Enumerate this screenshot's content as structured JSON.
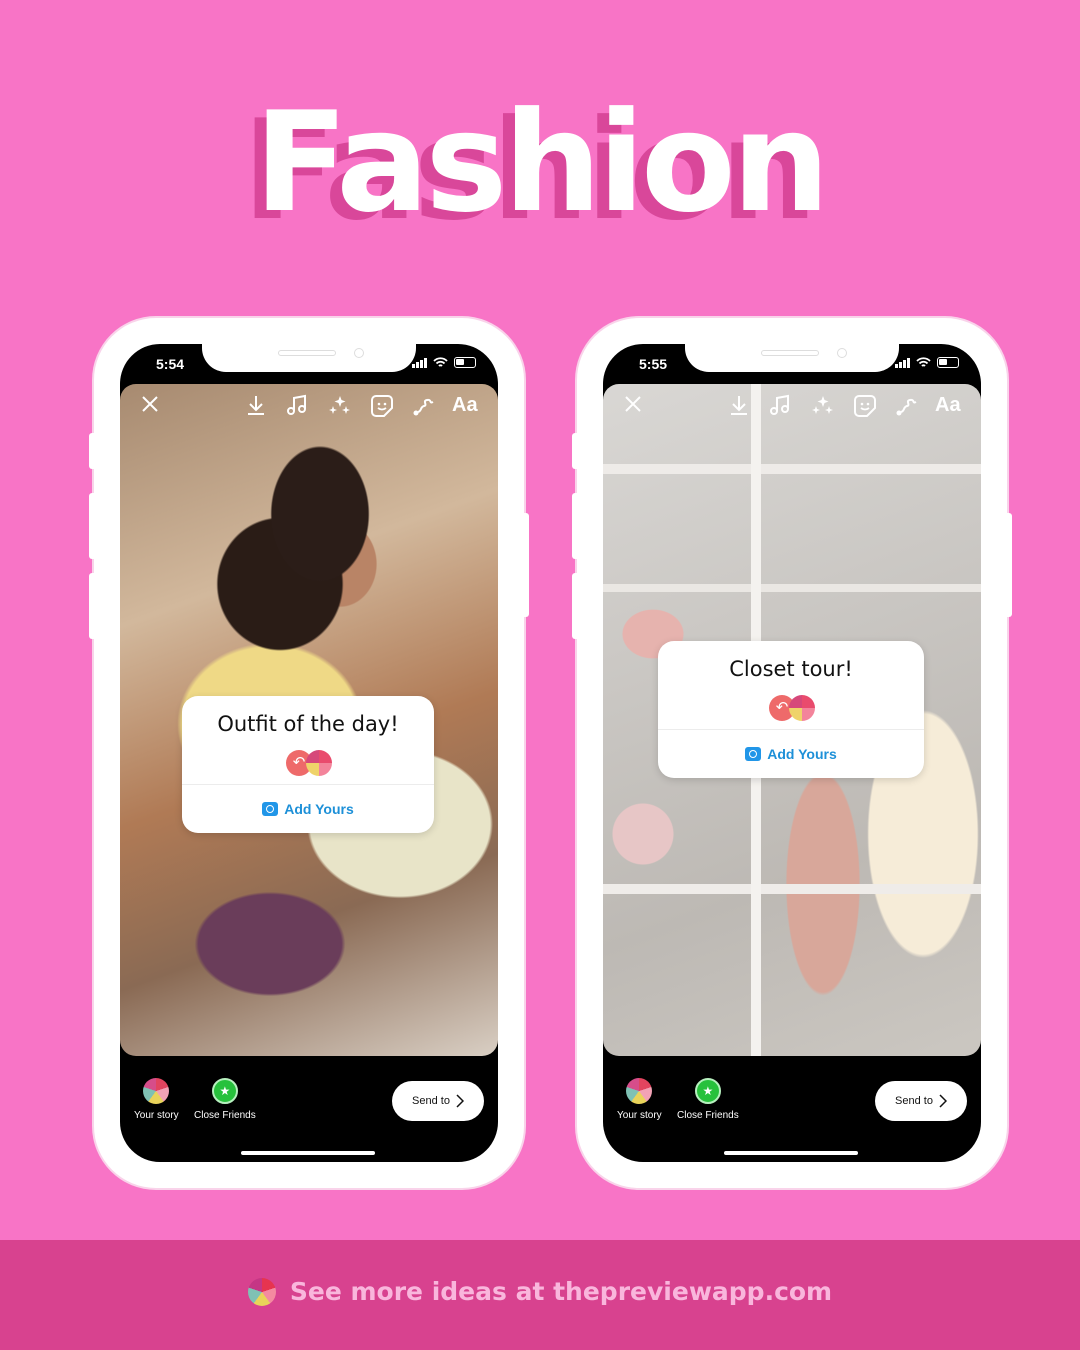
{
  "header": {
    "title": "Fashion"
  },
  "phones": [
    {
      "status": {
        "time": "5:54"
      },
      "toolbar": {
        "close": "close-icon",
        "download": "download-icon",
        "music": "music-icon",
        "effects": "sparkles-icon",
        "sticker": "sticker-icon",
        "draw": "draw-icon",
        "text": "Aa"
      },
      "sticker": {
        "prompt": "Outfit of the day!",
        "action": "Add Yours"
      },
      "bottom": {
        "your_story": "Your story",
        "close_friends": "Close Friends",
        "send_to": "Send to"
      }
    },
    {
      "status": {
        "time": "5:55"
      },
      "toolbar": {
        "close": "close-icon",
        "download": "download-icon",
        "music": "music-icon",
        "effects": "sparkles-icon",
        "sticker": "sticker-icon",
        "draw": "draw-icon",
        "text": "Aa"
      },
      "sticker": {
        "prompt": "Closet tour!",
        "action": "Add Yours"
      },
      "bottom": {
        "your_story": "Your story",
        "close_friends": "Close Friends",
        "send_to": "Send to"
      }
    }
  ],
  "footer": {
    "text": "See more ideas at thepreviewapp.com"
  },
  "colors": {
    "background": "#f874c6",
    "footer": "#d8428f",
    "title_shadow": "#d9479a",
    "link_blue": "#1d90d8"
  }
}
